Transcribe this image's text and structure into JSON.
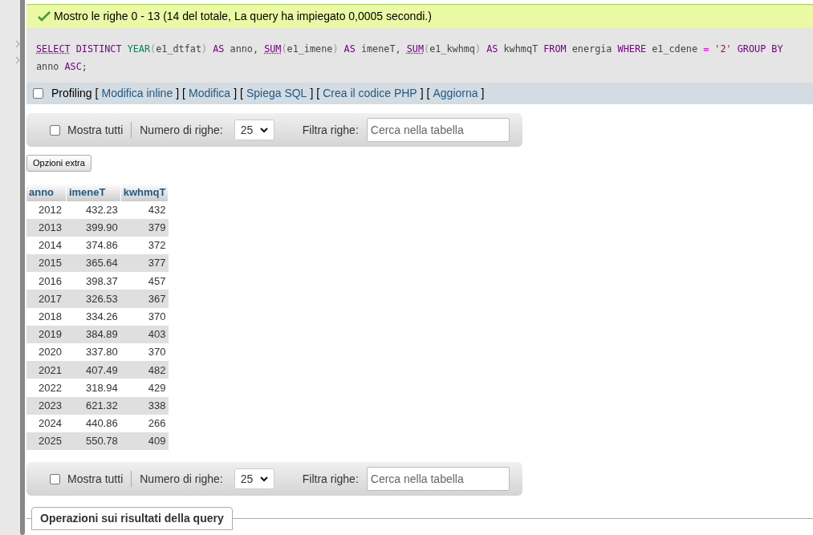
{
  "message": "Mostro le righe 0 - 13 (14 del totale, La query ha impiegato 0,0005 secondi.)",
  "sql": [
    {
      "t": "SELECT",
      "kind": "kwlink"
    },
    {
      "t": " DISTINCT",
      "kind": "kw"
    },
    {
      "t": " YEAR",
      "kind": "fn"
    },
    {
      "t": "(",
      "kind": "paren"
    },
    {
      "t": "e1_dtfat",
      "kind": "plain"
    },
    {
      "t": ")",
      "kind": "paren"
    },
    {
      "t": " AS",
      "kind": "kw"
    },
    {
      "t": " anno, ",
      "kind": "plain"
    },
    {
      "t": "SUM",
      "kind": "kwlink"
    },
    {
      "t": "(",
      "kind": "paren"
    },
    {
      "t": "e1_imene",
      "kind": "plain"
    },
    {
      "t": ")",
      "kind": "paren"
    },
    {
      "t": " AS",
      "kind": "kw"
    },
    {
      "t": " imeneT, ",
      "kind": "plain"
    },
    {
      "t": "SUM",
      "kind": "kwlink"
    },
    {
      "t": "(",
      "kind": "paren"
    },
    {
      "t": "e1_kwhmq",
      "kind": "plain"
    },
    {
      "t": ")",
      "kind": "paren"
    },
    {
      "t": " AS",
      "kind": "kw"
    },
    {
      "t": " kwhmqT ",
      "kind": "plain"
    },
    {
      "t": "FROM",
      "kind": "kw"
    },
    {
      "t": " energia ",
      "kind": "plain"
    },
    {
      "t": "WHERE",
      "kind": "kw"
    },
    {
      "t": " e1_cdene ",
      "kind": "plain"
    },
    {
      "t": "=",
      "kind": "op"
    },
    {
      "t": " '2'",
      "kind": "str"
    },
    {
      "t": " GROUP BY",
      "kind": "kw"
    },
    {
      "t": " anno ",
      "kind": "plain"
    },
    {
      "t": "ASC",
      "kind": "kw"
    },
    {
      "t": ";",
      "kind": "plain"
    }
  ],
  "profiling": {
    "label": "Profiling",
    "checked": false
  },
  "links": [
    {
      "open": "[",
      "label": "Modifica inline",
      "close": "]"
    },
    {
      "open": "[",
      "label": "Modifica",
      "close": "]"
    },
    {
      "open": "[",
      "label": "Spiega SQL",
      "close": "]"
    },
    {
      "open": "[",
      "label": "Crea il codice PHP",
      "close": "]"
    },
    {
      "open": "[",
      "label": "Aggiorna",
      "close": "]"
    }
  ],
  "navigation_top": {
    "show_all": "Mostra tutti",
    "show_all_checked": false,
    "rows_label": "Numero di righe:",
    "rows_value": "25",
    "filter_label": "Filtra righe:",
    "filter_placeholder": "Cerca nella tabella"
  },
  "extra_button": "Opzioni extra",
  "table": {
    "columns": [
      "anno",
      "imeneT",
      "kwhmqT"
    ],
    "rows": [
      [
        "2012",
        "432.23",
        "432"
      ],
      [
        "2013",
        "399.90",
        "379"
      ],
      [
        "2014",
        "374.86",
        "372"
      ],
      [
        "2015",
        "365.64",
        "377"
      ],
      [
        "2016",
        "398.37",
        "457"
      ],
      [
        "2017",
        "326.53",
        "367"
      ],
      [
        "2018",
        "334.26",
        "370"
      ],
      [
        "2019",
        "384.89",
        "403"
      ],
      [
        "2020",
        "337.80",
        "370"
      ],
      [
        "2021",
        "407.49",
        "482"
      ],
      [
        "2022",
        "318.94",
        "429"
      ],
      [
        "2023",
        "621.32",
        "338"
      ],
      [
        "2024",
        "440.86",
        "266"
      ],
      [
        "2025",
        "550.78",
        "409"
      ]
    ]
  },
  "navigation_bottom": {
    "show_all": "Mostra tutti",
    "show_all_checked": false,
    "rows_label": "Numero di righe:",
    "rows_value": "25",
    "filter_label": "Filtra righe:",
    "filter_placeholder": "Cerca nella tabella"
  },
  "operations_legend": "Operazioni sui risultati della query"
}
